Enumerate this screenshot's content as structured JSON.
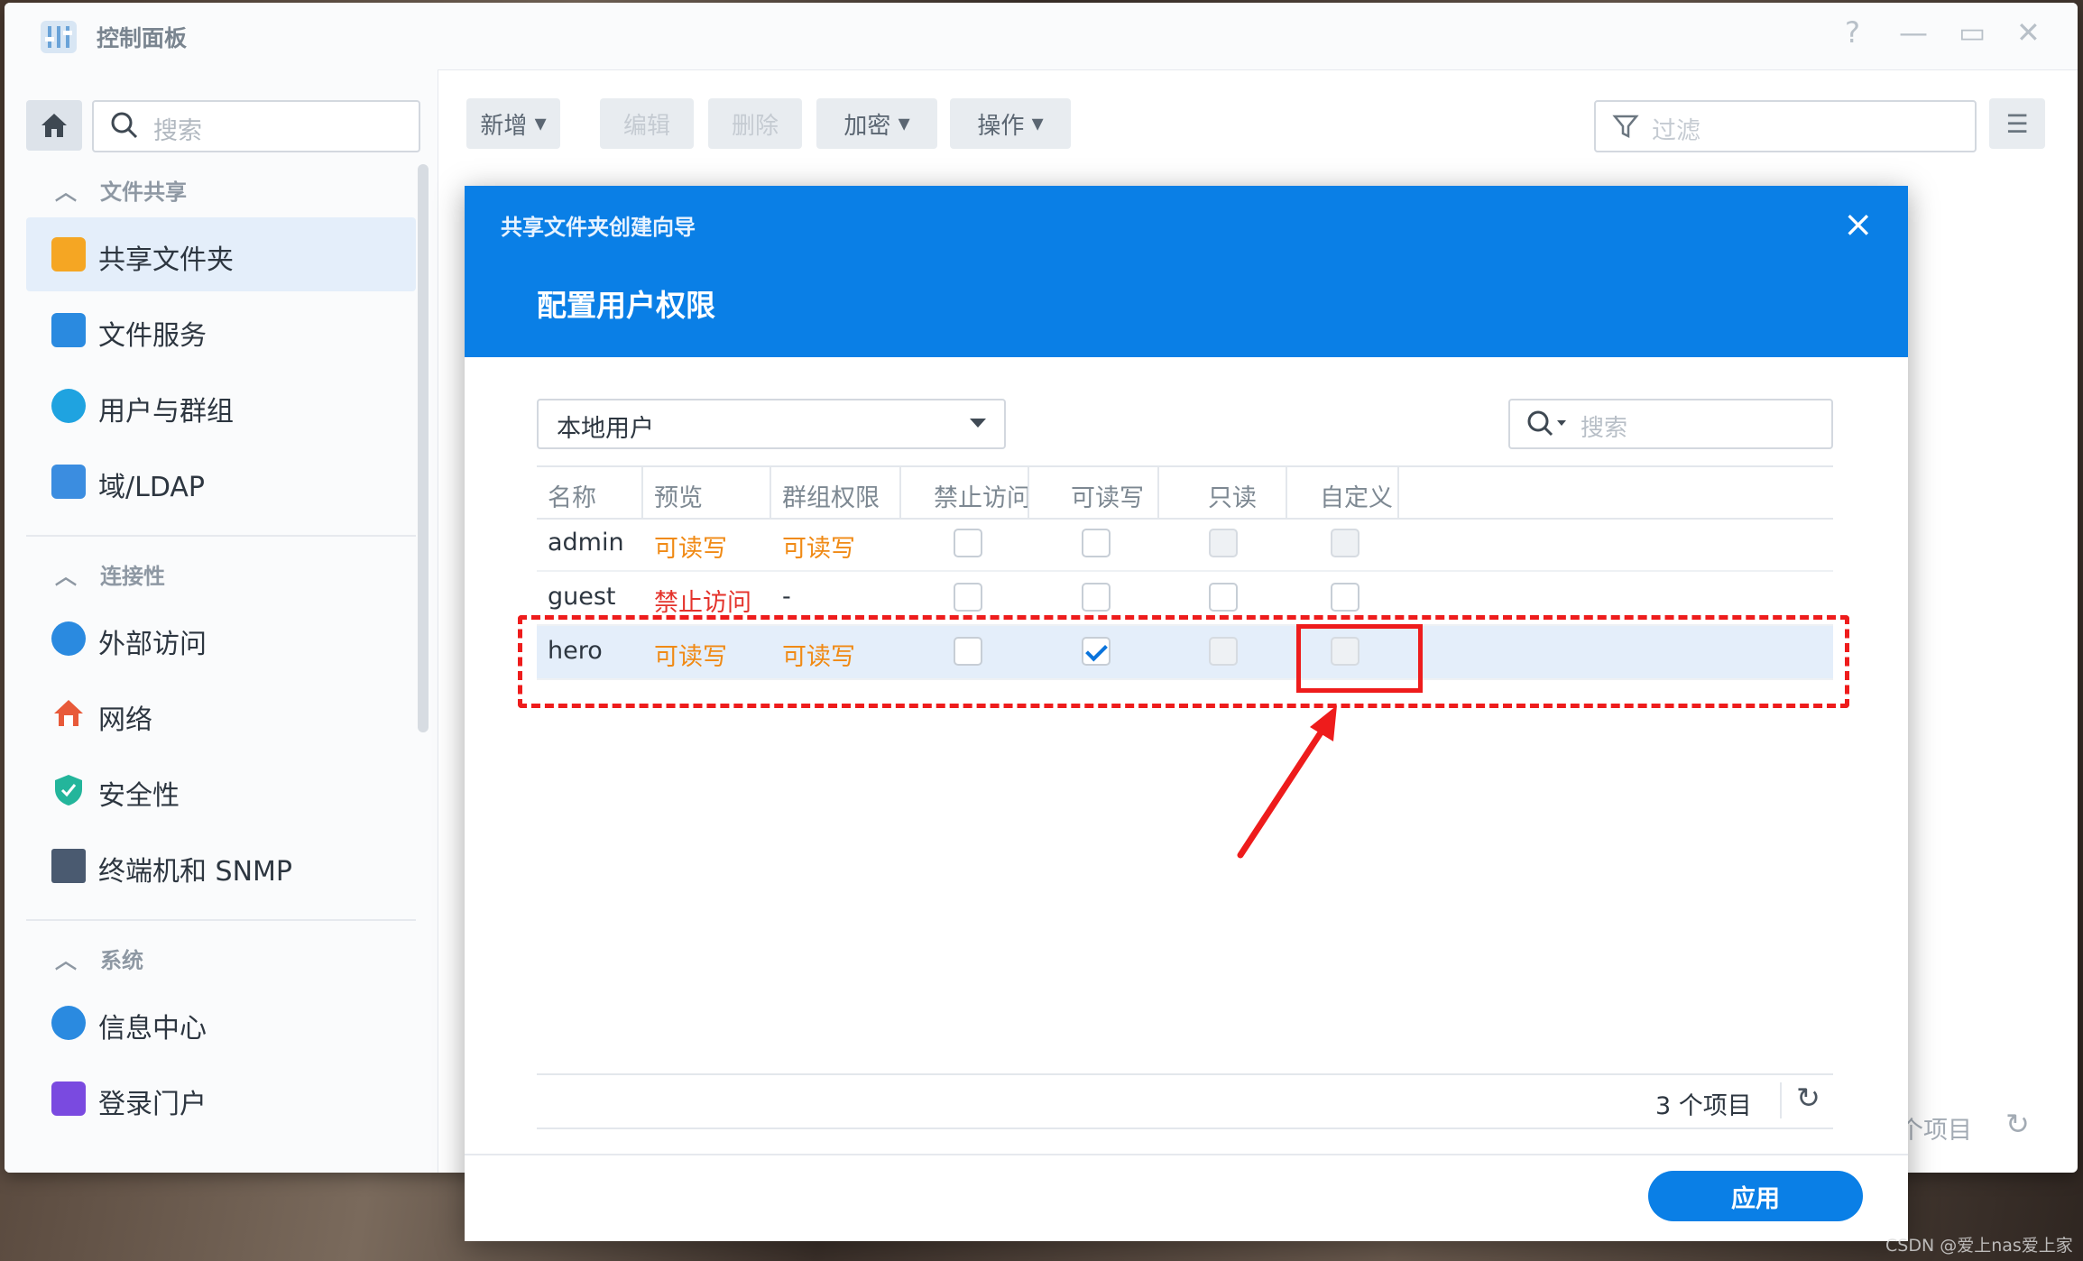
{
  "window": {
    "title": "控制面板",
    "controls": [
      "?",
      "—",
      "▭",
      "✕"
    ]
  },
  "sidebar": {
    "search_placeholder": "搜索",
    "sections": [
      {
        "label": "文件共享",
        "items": [
          {
            "label": "共享文件夹",
            "icon": "shared-folder-icon",
            "color": "#f5a623"
          },
          {
            "label": "文件服务",
            "icon": "file-services-icon",
            "color": "#2a8ae0"
          },
          {
            "label": "用户与群组",
            "icon": "user-group-icon",
            "color": "#1fa3e0"
          },
          {
            "label": "域/LDAP",
            "icon": "domain-ldap-icon",
            "color": "#3b8de0"
          }
        ]
      },
      {
        "label": "连接性",
        "items": [
          {
            "label": "外部访问",
            "icon": "external-access-icon",
            "color": "#2a8ae0"
          },
          {
            "label": "网络",
            "icon": "network-icon",
            "color": "#e85a3a"
          },
          {
            "label": "安全性",
            "icon": "security-icon",
            "color": "#23b59b"
          },
          {
            "label": "终端机和 SNMP",
            "icon": "terminal-icon",
            "color": "#4a5a70"
          }
        ]
      },
      {
        "label": "系统",
        "items": [
          {
            "label": "信息中心",
            "icon": "info-center-icon",
            "color": "#2a8ae0"
          },
          {
            "label": "登录门户",
            "icon": "login-portal-icon",
            "color": "#7a4ae0"
          }
        ]
      }
    ]
  },
  "toolbar": {
    "add": "新增",
    "edit": "编辑",
    "delete": "删除",
    "encrypt": "加密",
    "action": "操作",
    "filter_placeholder": "过滤"
  },
  "background_footer": "个项目",
  "dialog": {
    "wizard_title": "共享文件夹创建向导",
    "step_title": "配置用户权限",
    "close": "×",
    "user_type": "本地用户",
    "search_placeholder": "搜索",
    "columns": [
      "名称",
      "预览",
      "群组权限",
      "禁止访问",
      "可读写",
      "只读",
      "自定义"
    ],
    "rows": [
      {
        "name": "admin",
        "preview": "可读写",
        "group": "可读写",
        "deny": false,
        "rw": false,
        "ro": false,
        "custom": false,
        "disabled_cols": [
          "ro",
          "custom"
        ]
      },
      {
        "name": "guest",
        "preview": "禁止访问",
        "group": "-",
        "deny": false,
        "rw": false,
        "ro": false,
        "custom": false,
        "disabled_cols": []
      },
      {
        "name": "hero",
        "preview": "可读写",
        "group": "可读写",
        "deny": false,
        "rw": true,
        "ro": false,
        "custom": false,
        "disabled_cols": [
          "ro",
          "custom"
        ]
      }
    ],
    "footer_count": "3 个项目",
    "apply": "应用"
  },
  "watermark": "CSDN @爱上nas爱上家",
  "colors": {
    "accent": "#0a7fe6",
    "orange": "#f08a15",
    "red": "#e4322b",
    "annotation": "#ee1c1c"
  }
}
